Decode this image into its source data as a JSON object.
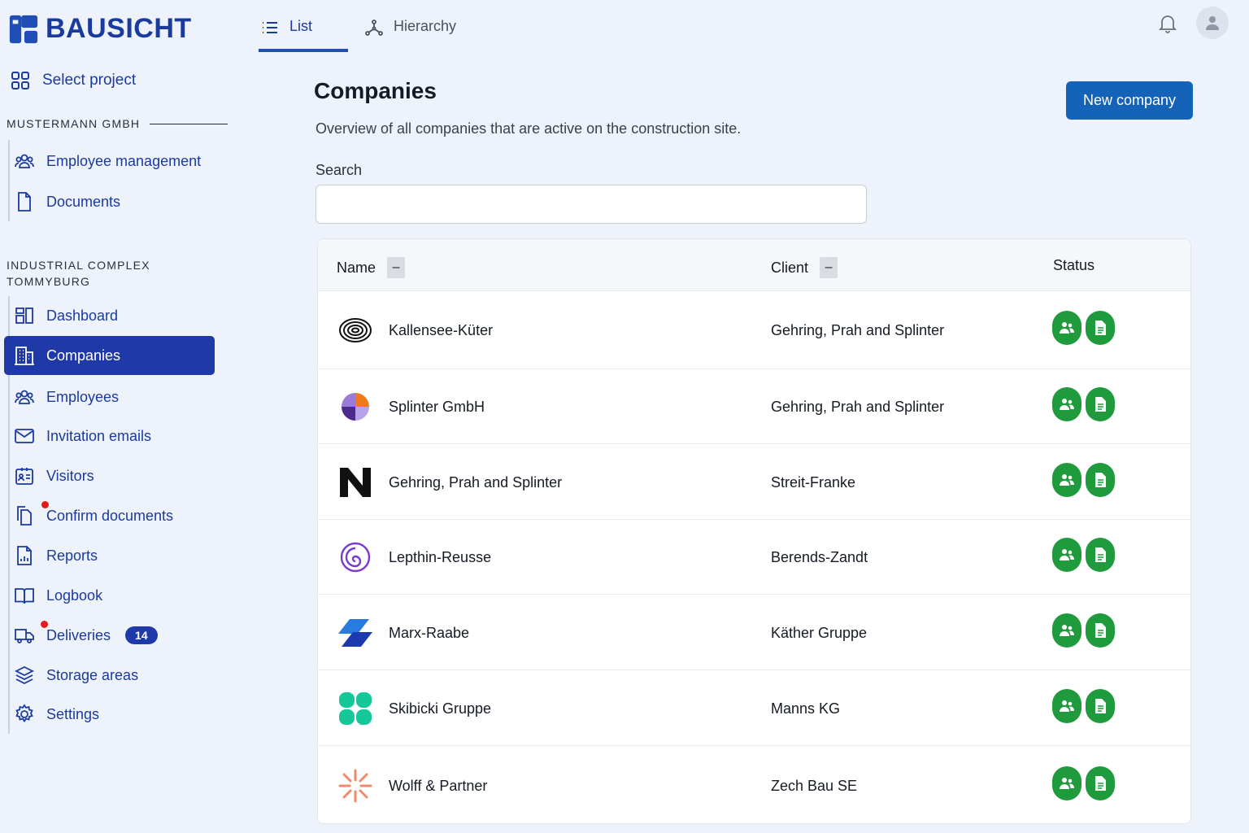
{
  "brand": {
    "name": "BAUSICHT"
  },
  "sidebar": {
    "select_project": "Select project",
    "org_section": "MUSTERMANN GMBH",
    "org_items": [
      {
        "label": "Employee management",
        "icon": "users-icon"
      },
      {
        "label": "Documents",
        "icon": "document-icon"
      }
    ],
    "project_section": "INDUSTRIAL COMPLEX TOMMYBURG",
    "project_items": [
      {
        "label": "Dashboard",
        "icon": "dashboard-icon"
      },
      {
        "label": "Companies",
        "icon": "building-icon",
        "active": true
      },
      {
        "label": "Employees",
        "icon": "users-icon"
      },
      {
        "label": "Invitation emails",
        "icon": "mail-icon"
      },
      {
        "label": "Visitors",
        "icon": "id-card-icon"
      },
      {
        "label": "Confirm documents",
        "icon": "documents-icon",
        "dot": true
      },
      {
        "label": "Reports",
        "icon": "report-icon"
      },
      {
        "label": "Logbook",
        "icon": "book-icon"
      },
      {
        "label": "Deliveries",
        "icon": "truck-icon",
        "dot": true,
        "badge": "14"
      },
      {
        "label": "Storage areas",
        "icon": "layers-icon"
      },
      {
        "label": "Settings",
        "icon": "gear-icon"
      }
    ]
  },
  "tabs": {
    "list": "List",
    "hierarchy": "Hierarchy"
  },
  "main": {
    "title": "Companies",
    "subtitle": "Overview of all companies that are active on the construction site.",
    "new_button": "New company",
    "search_label": "Search",
    "search_value": "",
    "columns": {
      "name": "Name",
      "client": "Client",
      "status": "Status"
    },
    "sort_symbol": "–",
    "rows": [
      {
        "name": "Kallensee-Küter",
        "client": "Gehring, Prah and Splinter",
        "logo": "rings-logo"
      },
      {
        "name": "Splinter GmbH",
        "client": "Gehring, Prah and Splinter",
        "logo": "petal-logo"
      },
      {
        "name": "Gehring, Prah and Splinter",
        "client": "Streit-Franke",
        "logo": "n-logo"
      },
      {
        "name": "Lepthin-Reusse",
        "client": "Berends-Zandt",
        "logo": "spiral-logo"
      },
      {
        "name": "Marx-Raabe",
        "client": "Käther Gruppe",
        "logo": "parallelogram-logo"
      },
      {
        "name": "Skibicki Gruppe",
        "client": "Manns KG",
        "logo": "clover-logo"
      },
      {
        "name": "Wolff & Partner",
        "client": "Zech Bau SE",
        "logo": "burst-logo"
      }
    ]
  },
  "colors": {
    "primary": "#1f3aa8",
    "button": "#1463b8",
    "status_green": "#1f9a3c",
    "alert_dot": "#e21b1b"
  }
}
